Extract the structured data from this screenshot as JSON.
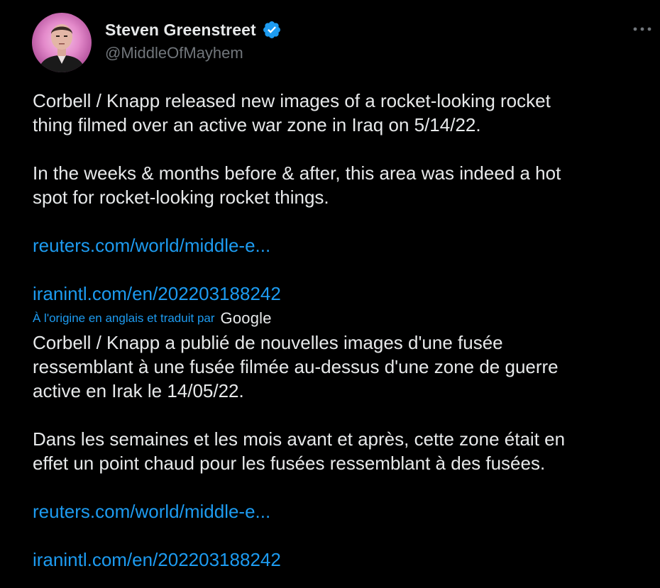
{
  "author": {
    "display_name": "Steven Greenstreet",
    "handle": "@MiddleOfMayhem",
    "verified": true,
    "avatar_icon": "portrait-avatar"
  },
  "menu": {
    "icon": "more-horizontal-icon"
  },
  "tweet": {
    "original": {
      "paragraph1": [
        "Corbell / Knapp released new images of a rocket-looking rocket",
        "thing filmed over an active war zone in Iraq on 5/14/22."
      ],
      "paragraph2": [
        "In the weeks & months before & after, this area was indeed a hot",
        "spot for rocket-looking rocket things."
      ],
      "link1": "reuters.com/world/middle-e...",
      "link2": "iranintl.com/en/202203188242"
    },
    "translation_note": {
      "label": "À l'origine en anglais et traduit par",
      "provider": "Google"
    },
    "translated": {
      "paragraph1": [
        "Corbell / Knapp a publié de nouvelles images d'une fusée",
        "ressemblant à une fusée filmée au-dessus d'une zone de guerre",
        "active en Irak le 14/05/22."
      ],
      "paragraph2": [
        "Dans les semaines et les mois avant et après, cette zone était en",
        "effet un point chaud pour les fusées ressemblant à des fusées."
      ],
      "link1": "reuters.com/world/middle-e...",
      "link2": "iranintl.com/en/202203188242"
    }
  },
  "colors": {
    "background": "#000000",
    "text": "#e7e9ea",
    "muted": "#71767b",
    "link": "#1d9bf0",
    "verified_badge": "#1d9bf0"
  }
}
